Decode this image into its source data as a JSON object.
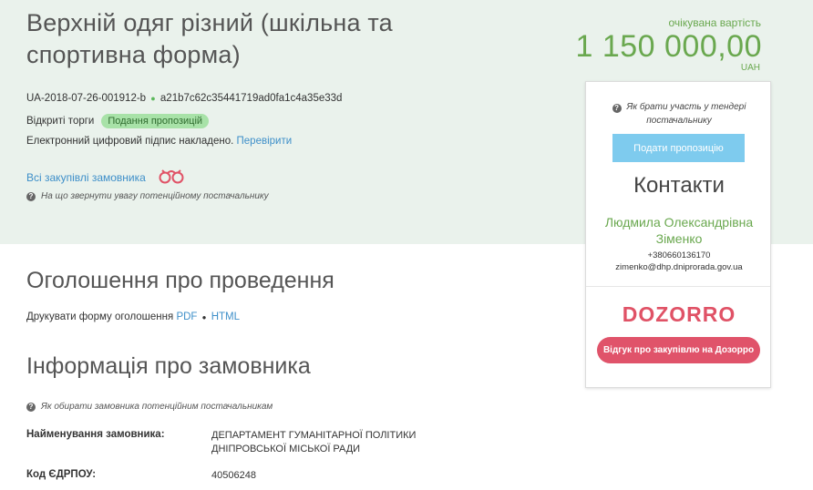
{
  "tender": {
    "title": "Верхній одяг різний (шкільна та спортивна форма)",
    "id": "UA-2018-07-26-001912-b",
    "hash": "a21b7c62c35441719ad0fa1c4a35e33d",
    "procedure_type": "Відкриті торги",
    "status": "Подання пропозицій",
    "signature_text": "Електронний цифровий підпис накладено.",
    "signature_check": "Перевірити",
    "all_purchases": "Всі закупівлі замовника",
    "supplier_note": "На що звернути увагу потенційному постачальнику"
  },
  "cost": {
    "label": "очікувана вартість",
    "value": "1 150 000,00",
    "currency": "UAH"
  },
  "sidebar": {
    "howto": "Як брати участь у тендері постачальнику",
    "submit_button": "Подати пропозицію",
    "contacts_title": "Контакти",
    "contact_name": "Людмила Олександрівна Зіменко",
    "contact_phone": "+380660136170",
    "contact_email": "zimenko@dhp.dniprorada.gov.ua",
    "dozorro_logo": "DOZORRO",
    "dozorro_button": "Відгук про закупівлю на Дозорро"
  },
  "announcement": {
    "heading": "Оголошення про проведення",
    "print_label": "Друкувати форму оголошення",
    "pdf": "PDF",
    "html": "HTML"
  },
  "customer": {
    "heading": "Інформація про замовника",
    "hint": "Як обирати замовника потенційним постачальникам",
    "name_label": "Найменування замовника:",
    "name_line1": "ДЕПАРТАМЕНТ ГУМАНІТАРНОЇ ПОЛІТИКИ",
    "name_line2": "ДНІПРОВСЬКОЇ МІСЬКОЇ РАДИ",
    "edrpou_label": "Код ЄДРПОУ:",
    "edrpou_value": "40506248"
  },
  "colors": {
    "band": "#eaf2ec",
    "accent_green": "#6aa84f",
    "link_blue": "#3e8fc9",
    "dozorro_red": "#e0536a",
    "submit_blue": "#7ecbee"
  }
}
